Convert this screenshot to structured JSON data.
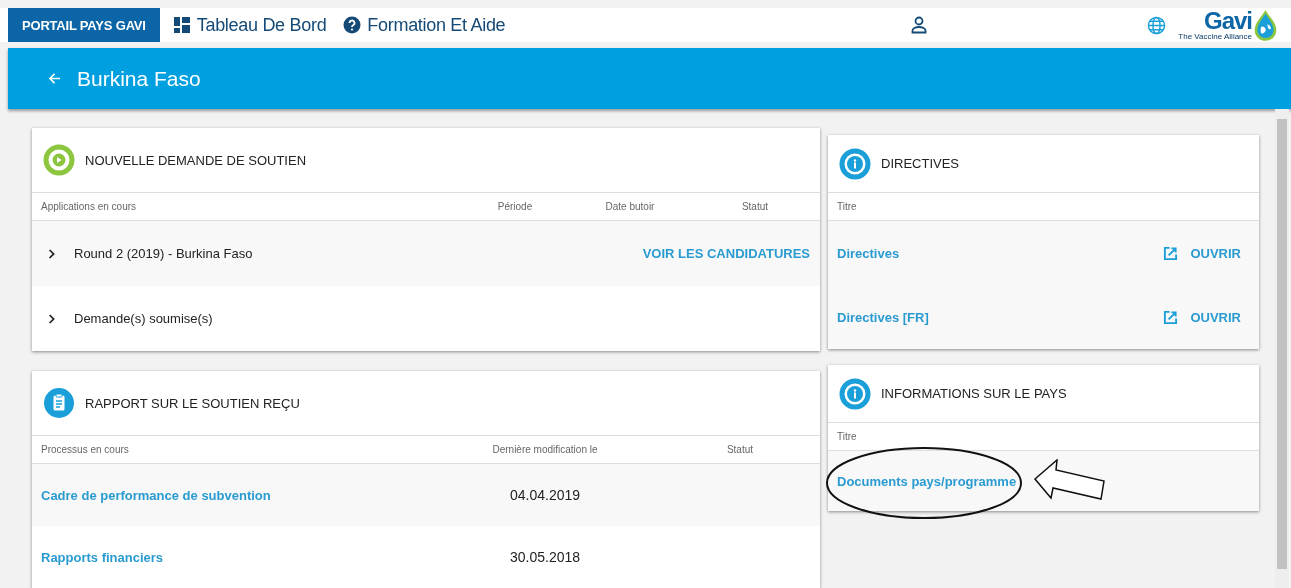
{
  "nav": {
    "brand": "PORTAIL PAYS GAVI",
    "links": [
      {
        "kind": "dashboard",
        "label": "Tableau De Bord"
      },
      {
        "kind": "help",
        "label": "Formation Et Aide"
      }
    ],
    "logo": {
      "name": "Gavi",
      "tagline": "The Vaccine Alliance"
    }
  },
  "banner": {
    "title": "Burkina Faso"
  },
  "applications": {
    "title": "NOUVELLE DEMANDE DE SOUTIEN",
    "columns": [
      "Applications en cours",
      "Période",
      "Date butoir",
      "Statut"
    ],
    "rows": [
      {
        "label": "Round 2 (2019) - Burkina Faso",
        "action": "VOIR LES CANDIDATURES",
        "expanded": false
      },
      {
        "label": "Demande(s) soumise(s)",
        "expanded": false
      }
    ]
  },
  "reports": {
    "title": "RAPPORT SUR LE SOUTIEN REÇU",
    "columns": [
      "Processus en cours",
      "Dernière modification le",
      "Statut"
    ],
    "rows": [
      {
        "label": "Cadre de performance de subvention",
        "date": "04.04.2019"
      },
      {
        "label": "Rapports financiers",
        "date": "30.05.2018"
      }
    ]
  },
  "guidelines": {
    "title": "DIRECTIVES",
    "column": "Titre",
    "rows": [
      {
        "label": "Directives",
        "action": "OUVRIR"
      },
      {
        "label": "Directives [FR]",
        "action": "OUVRIR"
      }
    ]
  },
  "country_info": {
    "title": "INFORMATIONS SUR LE PAYS",
    "column": "Titre",
    "rows": [
      {
        "label": "Documents pays/programme",
        "annotated": true
      }
    ]
  }
}
